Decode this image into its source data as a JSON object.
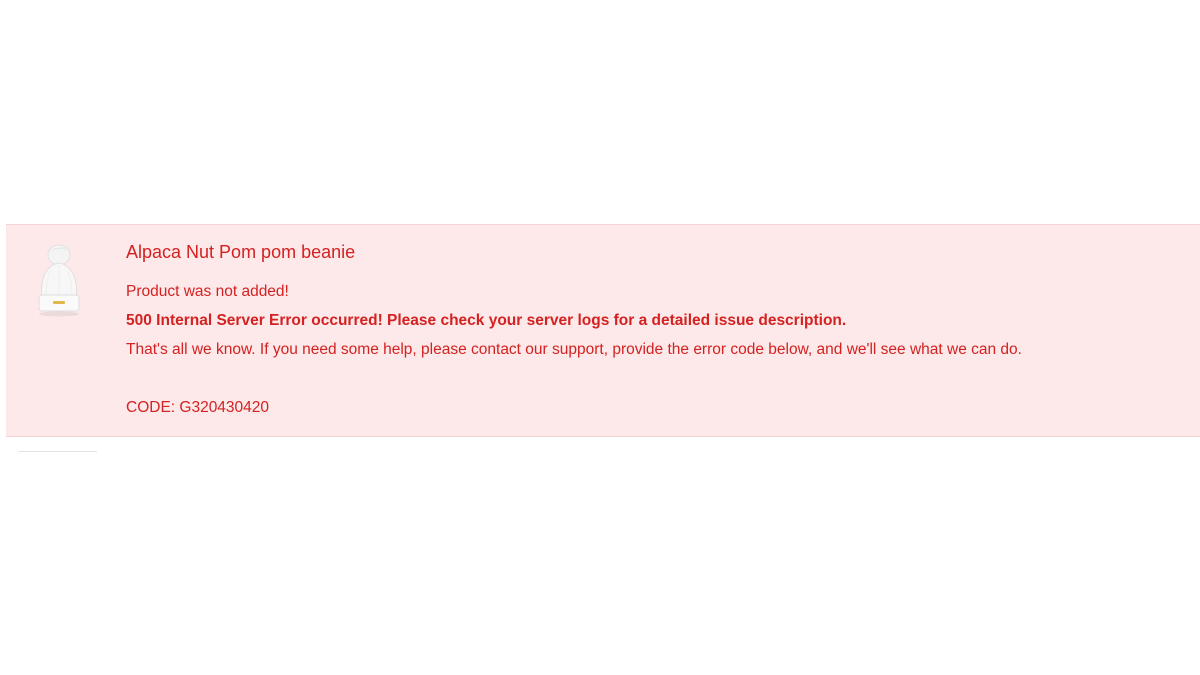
{
  "banner": {
    "product_name": "Alpaca Nut Pom pom beanie",
    "status_message": "Product was not added!",
    "error_headline": "500 Internal Server Error occurred! Please check your server logs for a detailed issue description.",
    "help_text": "That's all we know. If you need some help, please contact our support, provide the error code below, and we'll see what we can do.",
    "error_code": "CODE: G320430420",
    "colors": {
      "text": "#d42121",
      "background": "#fde9e9"
    },
    "thumbnail_icon": "white-beanie-product-image"
  }
}
